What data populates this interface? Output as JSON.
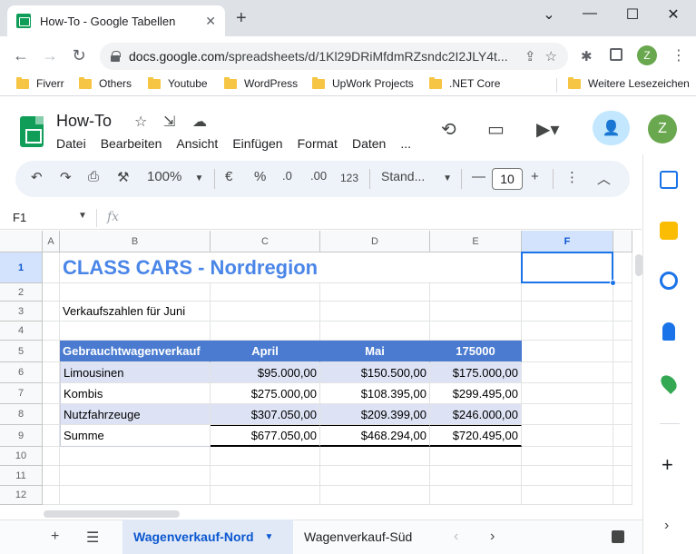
{
  "browser": {
    "tab_title": "How-To - Google Tabellen",
    "tab_close": "✕",
    "new_tab": "+",
    "window_controls": [
      "⌄",
      "—",
      "☐",
      "✕"
    ],
    "url_host": "docs.google.com",
    "url_path": "/spreadsheets/d/1Kl29DRiMfdmRZsndc2I2JLY4t...",
    "profile_initial": "Z",
    "bookmarks": [
      "Fiverr",
      "Others",
      "Youtube",
      "WordPress",
      "UpWork Projects",
      ".NET Core"
    ],
    "other_bookmarks": "Weitere Lesezeichen"
  },
  "sheets": {
    "title": "How-To",
    "menu": [
      "Datei",
      "Bearbeiten",
      "Ansicht",
      "Einfügen",
      "Format",
      "Daten",
      "..."
    ],
    "profile_initial": "Z",
    "toolbar": {
      "zoom": "100%",
      "currency": "€",
      "percent": "%",
      "dec_decrease": ".0",
      "dec_increase": ".00",
      "number_format": "123",
      "font": "Stand...",
      "font_size": "10"
    },
    "name_box": "F1",
    "fx": "fx"
  },
  "grid": {
    "columns": [
      "A",
      "B",
      "C",
      "D",
      "E",
      "F"
    ],
    "rows": [
      "1",
      "2",
      "3",
      "4",
      "5",
      "6",
      "7",
      "8",
      "9",
      "10",
      "11",
      "12"
    ],
    "selected_column": "F",
    "selected_row": "1",
    "title": "CLASS CARS - Nordregion",
    "subtitle": "Verkaufszahlen für Juni",
    "table_header": [
      "Gebrauchtwagenverkauf",
      "April",
      "Mai",
      "175000"
    ],
    "table_rows": [
      [
        "Limousinen",
        "$95.000,00",
        "$150.500,00",
        "$175.000,00"
      ],
      [
        "Kombis",
        "$275.000,00",
        "$108.395,00",
        "$299.495,00"
      ],
      [
        "Nutzfahrzeuge",
        "$307.050,00",
        "$209.399,00",
        "$246.000,00"
      ],
      [
        "Summe",
        "$677.050,00",
        "$468.294,00",
        "$720.495,00"
      ]
    ],
    "colors": {
      "header_bg": "#4a7bd0",
      "band_bg": "#dde3f5",
      "title_color": "#4a86e8"
    }
  },
  "sheet_tabs": {
    "active": "Wagenverkauf-Nord",
    "other": "Wagenverkauf-Süd"
  }
}
